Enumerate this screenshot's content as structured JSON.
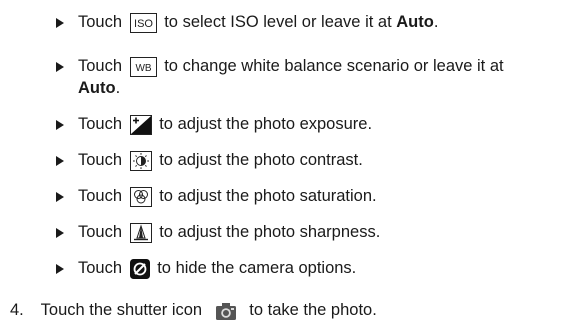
{
  "items": [
    {
      "prefix": "Touch",
      "suffix": "to select ISO level or leave it at",
      "bold": "Auto",
      "end": "."
    },
    {
      "prefix": "Touch",
      "suffix": "to change white balance scenario or leave it at",
      "bold": "Auto",
      "end": "."
    },
    {
      "prefix": "Touch",
      "suffix": "to adjust the photo exposure."
    },
    {
      "prefix": "Touch",
      "suffix": "to adjust the photo contrast."
    },
    {
      "prefix": "Touch",
      "suffix": "to adjust the photo saturation."
    },
    {
      "prefix": "Touch",
      "suffix": "to adjust the photo sharpness."
    },
    {
      "prefix": "Touch",
      "suffix": "to hide the camera options."
    }
  ],
  "icons": {
    "iso_label": "ISO",
    "wb_label": "WB"
  },
  "step4": {
    "number": "4.",
    "prefix": "Touch the shutter icon",
    "suffix": "to take the photo."
  }
}
